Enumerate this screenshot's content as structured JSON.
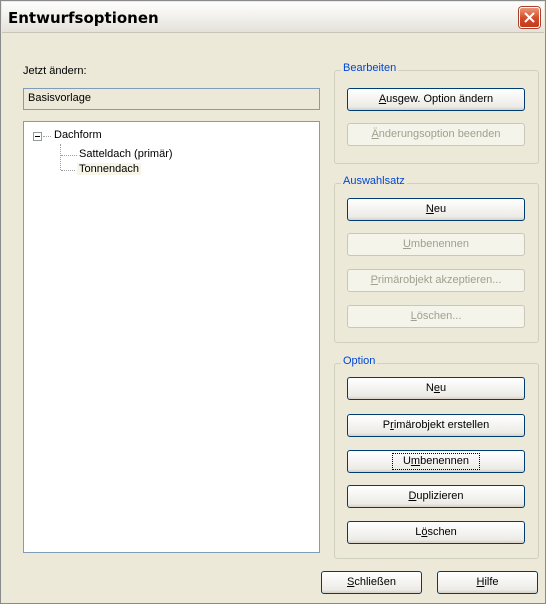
{
  "window": {
    "title": "Entwurfsoptionen"
  },
  "left": {
    "change_now_label": "Jetzt ändern:",
    "current_value": "Basisvorlage",
    "tree": {
      "root": "Dachform",
      "children": [
        "Satteldach (primär)",
        "Tonnendach"
      ]
    }
  },
  "edit_group": {
    "legend": "Bearbeiten",
    "change_option": {
      "pre": "",
      "key": "A",
      "post": "usgew. Option ändern"
    },
    "end_option": {
      "pre": "",
      "key": "Ä",
      "post": "nderungsoption beenden"
    }
  },
  "selection_group": {
    "legend": "Auswahlsatz",
    "new": {
      "pre": "",
      "key": "N",
      "post": "eu"
    },
    "rename": {
      "pre": "",
      "key": "U",
      "post": "mbenennen"
    },
    "accept_primary": {
      "pre": "",
      "key": "P",
      "post": "rimärobjekt akzeptieren..."
    },
    "delete": {
      "pre": "",
      "key": "L",
      "post": "öschen..."
    }
  },
  "option_group": {
    "legend": "Option",
    "new": {
      "pre": "N",
      "key": "e",
      "post": "u"
    },
    "create_primary": {
      "pre": "P",
      "key": "r",
      "post": "imärobjekt erstellen"
    },
    "rename": {
      "pre": "U",
      "key": "m",
      "post": "benennen"
    },
    "duplicate": {
      "pre": "",
      "key": "D",
      "post": "uplizieren"
    },
    "delete": {
      "pre": "L",
      "key": "ö",
      "post": "schen"
    }
  },
  "footer": {
    "close": {
      "pre": "",
      "key": "S",
      "post": "chließen"
    },
    "help": {
      "pre": "",
      "key": "H",
      "post": "ilfe"
    }
  }
}
